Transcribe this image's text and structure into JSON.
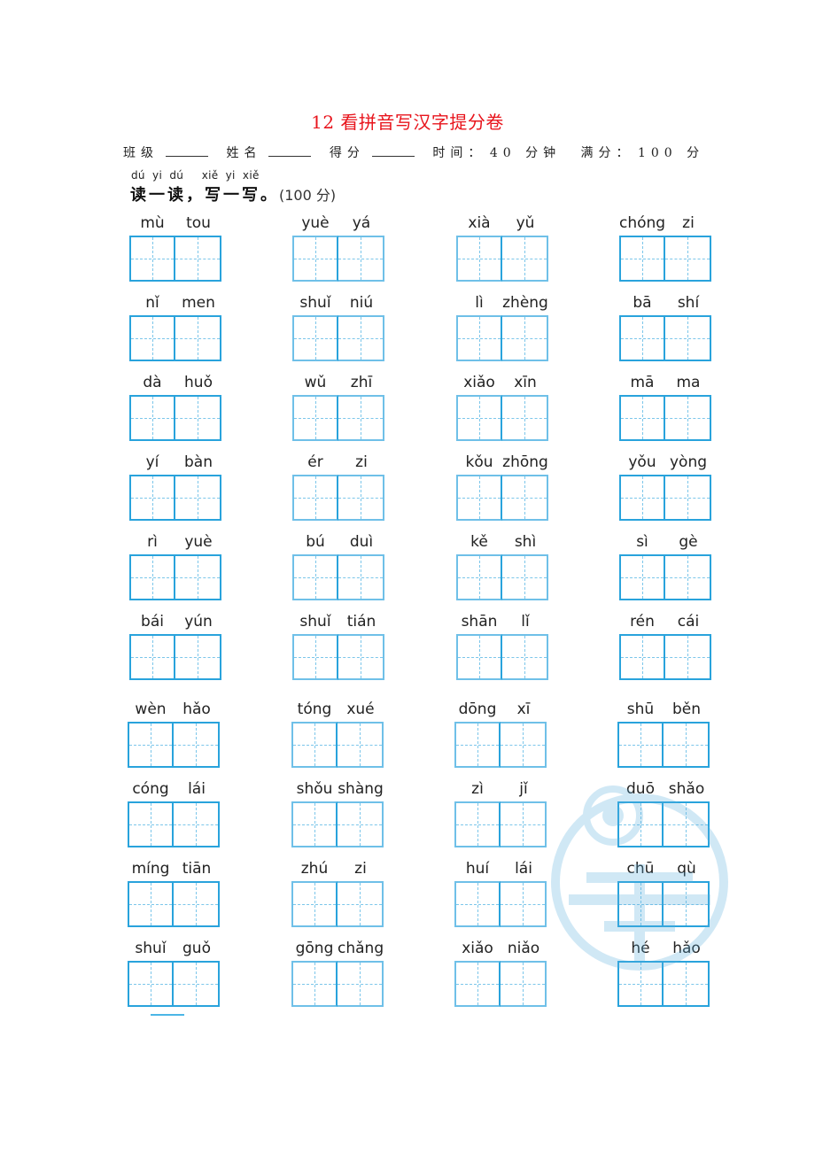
{
  "title": "12 看拼音写汉字提分卷",
  "info": {
    "class_label": "班级",
    "name_label": "姓名",
    "score_label": "得分",
    "time_label": "时间：",
    "time_value": "40 分钟",
    "full_score_label": "满分：",
    "full_score_value": "100 分"
  },
  "instruction": {
    "pinyin": "dú  yi  dú     xiě  yi  xiě",
    "text": "读一读，写一写。",
    "score": "(100 分)"
  },
  "colors": {
    "title": "#e8141c",
    "grid": "#29a3dc",
    "grid_dashed": "#7cc6ea"
  },
  "words": [
    [
      "mù",
      "tou"
    ],
    [
      "yuè",
      "yá"
    ],
    [
      "xià",
      "yǔ"
    ],
    [
      "chóng",
      "zi"
    ],
    [
      "nǐ",
      "men"
    ],
    [
      "shuǐ",
      "niú"
    ],
    [
      "lì",
      "zhèng"
    ],
    [
      "bā",
      "shí"
    ],
    [
      "dà",
      "huǒ"
    ],
    [
      "wǔ",
      "zhī"
    ],
    [
      "xiǎo",
      "xīn"
    ],
    [
      "mā",
      "ma"
    ],
    [
      "yí",
      "bàn"
    ],
    [
      "ér",
      "zi"
    ],
    [
      "kǒu",
      "zhōng"
    ],
    [
      "yǒu",
      "yòng"
    ],
    [
      "rì",
      "yuè"
    ],
    [
      "bú",
      "duì"
    ],
    [
      "kě",
      "shì"
    ],
    [
      "sì",
      "gè"
    ],
    [
      "bái",
      "yún"
    ],
    [
      "shuǐ",
      "tián"
    ],
    [
      "shān",
      "lǐ"
    ],
    [
      "rén",
      "cái"
    ],
    [
      "wèn",
      "hǎo"
    ],
    [
      "tóng",
      "xué"
    ],
    [
      "dōng",
      "xī"
    ],
    [
      "shū",
      "běn"
    ],
    [
      "cóng",
      "lái"
    ],
    [
      "shǒu",
      "shàng"
    ],
    [
      "zì",
      "jǐ"
    ],
    [
      "duō",
      "shǎo"
    ],
    [
      "míng",
      "tiān"
    ],
    [
      "zhú",
      "zi"
    ],
    [
      "huí",
      "lái"
    ],
    [
      "chū",
      "qù"
    ],
    [
      "shuǐ",
      "guǒ"
    ],
    [
      "gōng",
      "chǎng"
    ],
    [
      "xiǎo",
      "niǎo"
    ],
    [
      "hé",
      "hǎo"
    ]
  ]
}
